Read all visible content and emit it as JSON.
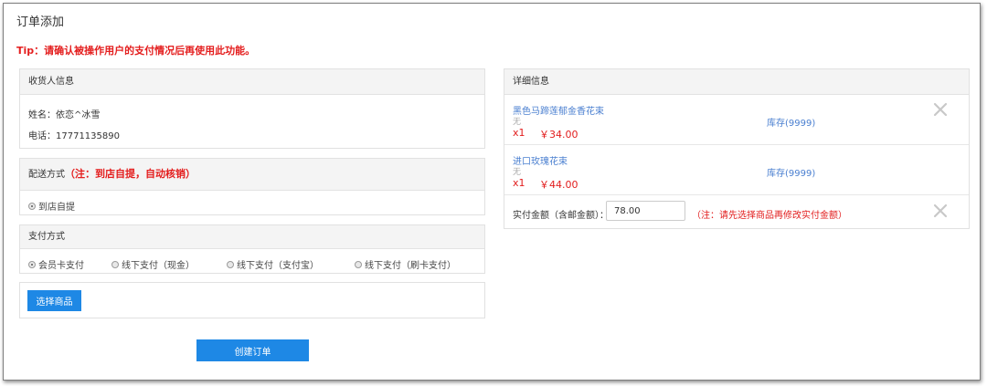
{
  "page_title": "订单添加",
  "tip": "Tip：请确认被操作用户的支付情况后再使用此功能。",
  "recipient": {
    "header": "收货人信息",
    "name_line": "姓名：依恋^冰雪",
    "phone_line": "电话：17771135890"
  },
  "delivery": {
    "header": "配送方式",
    "note": "（注：到店自提，自动核销）",
    "options": [
      "到店自提"
    ]
  },
  "payment": {
    "header": "支付方式",
    "options": [
      "会员卡支付",
      "线下支付（现金）",
      "线下支付（支付宝）",
      "线下支付（刷卡支付）"
    ]
  },
  "select_products_button": "选择商品",
  "create_order_button": "创建订单",
  "details": {
    "header": "详细信息",
    "items": [
      {
        "name": "黑色马蹄莲郁金香花束",
        "spec": "无",
        "qty": "x1",
        "price": "￥34.00",
        "stock": "库存(9999)"
      },
      {
        "name": "进口玫瑰花束",
        "spec": "无",
        "qty": "x1",
        "price": "￥44.00",
        "stock": "库存(9999)"
      }
    ],
    "amount_label": "实付金额（含邮金额）：",
    "amount_value": "78.00",
    "amount_note": "（注：请先选择商品再修改实付金额）"
  },
  "colors": {
    "accent_blue": "#1e88e5",
    "warning_red": "#e41e1e",
    "link_blue": "#4a7fd0"
  }
}
